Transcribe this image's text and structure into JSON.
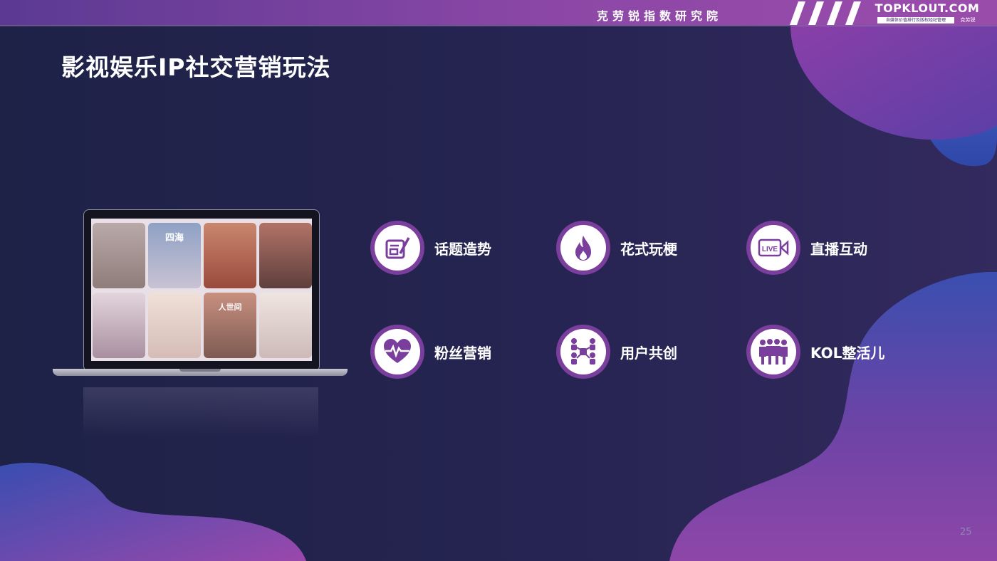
{
  "header": {
    "brand_cn": "克劳锐指数研究院",
    "logo_main": "TOPKLOUT.COM",
    "logo_sub": "自媒体价值排行及版权经纪管理",
    "logo_sub_cn": "克劳锐"
  },
  "title": "影视娱乐IP社交营销玩法",
  "laptop": {
    "poster_texts": [
      "四海",
      "人世间"
    ]
  },
  "features": [
    {
      "label": "话题造势",
      "icon": "edit-board-icon"
    },
    {
      "label": "花式玩梗",
      "icon": "flame-icon"
    },
    {
      "label": "直播互动",
      "icon": "live-camera-icon"
    },
    {
      "label": "粉丝营销",
      "icon": "heart-pulse-icon"
    },
    {
      "label": "用户共创",
      "icon": "network-people-icon"
    },
    {
      "label": "KOL整活儿",
      "icon": "crowd-icon"
    }
  ],
  "page_number": "25",
  "colors": {
    "accent": "#7a3e9d",
    "bar": "#8c47a6",
    "background": "#24234a"
  }
}
